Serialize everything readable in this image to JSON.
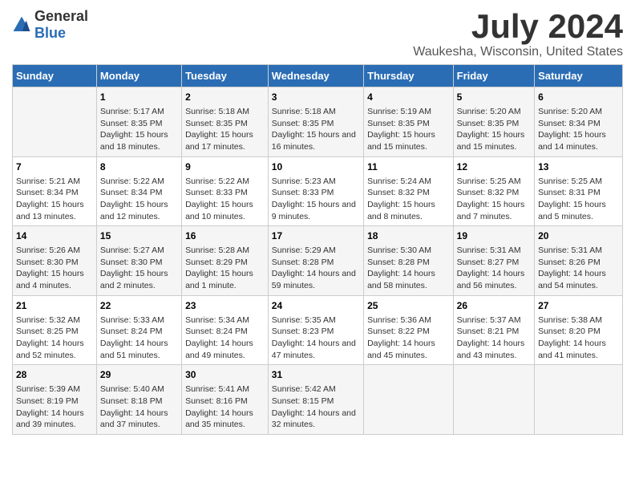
{
  "logo": {
    "general": "General",
    "blue": "Blue"
  },
  "header": {
    "title": "July 2024",
    "subtitle": "Waukesha, Wisconsin, United States"
  },
  "columns": [
    "Sunday",
    "Monday",
    "Tuesday",
    "Wednesday",
    "Thursday",
    "Friday",
    "Saturday"
  ],
  "weeks": [
    [
      {
        "day": "",
        "info": ""
      },
      {
        "day": "1",
        "info": "Sunrise: 5:17 AM\nSunset: 8:35 PM\nDaylight: 15 hours and 18 minutes."
      },
      {
        "day": "2",
        "info": "Sunrise: 5:18 AM\nSunset: 8:35 PM\nDaylight: 15 hours and 17 minutes."
      },
      {
        "day": "3",
        "info": "Sunrise: 5:18 AM\nSunset: 8:35 PM\nDaylight: 15 hours and 16 minutes."
      },
      {
        "day": "4",
        "info": "Sunrise: 5:19 AM\nSunset: 8:35 PM\nDaylight: 15 hours and 15 minutes."
      },
      {
        "day": "5",
        "info": "Sunrise: 5:20 AM\nSunset: 8:35 PM\nDaylight: 15 hours and 15 minutes."
      },
      {
        "day": "6",
        "info": "Sunrise: 5:20 AM\nSunset: 8:34 PM\nDaylight: 15 hours and 14 minutes."
      }
    ],
    [
      {
        "day": "7",
        "info": "Sunrise: 5:21 AM\nSunset: 8:34 PM\nDaylight: 15 hours and 13 minutes."
      },
      {
        "day": "8",
        "info": "Sunrise: 5:22 AM\nSunset: 8:34 PM\nDaylight: 15 hours and 12 minutes."
      },
      {
        "day": "9",
        "info": "Sunrise: 5:22 AM\nSunset: 8:33 PM\nDaylight: 15 hours and 10 minutes."
      },
      {
        "day": "10",
        "info": "Sunrise: 5:23 AM\nSunset: 8:33 PM\nDaylight: 15 hours and 9 minutes."
      },
      {
        "day": "11",
        "info": "Sunrise: 5:24 AM\nSunset: 8:32 PM\nDaylight: 15 hours and 8 minutes."
      },
      {
        "day": "12",
        "info": "Sunrise: 5:25 AM\nSunset: 8:32 PM\nDaylight: 15 hours and 7 minutes."
      },
      {
        "day": "13",
        "info": "Sunrise: 5:25 AM\nSunset: 8:31 PM\nDaylight: 15 hours and 5 minutes."
      }
    ],
    [
      {
        "day": "14",
        "info": "Sunrise: 5:26 AM\nSunset: 8:30 PM\nDaylight: 15 hours and 4 minutes."
      },
      {
        "day": "15",
        "info": "Sunrise: 5:27 AM\nSunset: 8:30 PM\nDaylight: 15 hours and 2 minutes."
      },
      {
        "day": "16",
        "info": "Sunrise: 5:28 AM\nSunset: 8:29 PM\nDaylight: 15 hours and 1 minute."
      },
      {
        "day": "17",
        "info": "Sunrise: 5:29 AM\nSunset: 8:28 PM\nDaylight: 14 hours and 59 minutes."
      },
      {
        "day": "18",
        "info": "Sunrise: 5:30 AM\nSunset: 8:28 PM\nDaylight: 14 hours and 58 minutes."
      },
      {
        "day": "19",
        "info": "Sunrise: 5:31 AM\nSunset: 8:27 PM\nDaylight: 14 hours and 56 minutes."
      },
      {
        "day": "20",
        "info": "Sunrise: 5:31 AM\nSunset: 8:26 PM\nDaylight: 14 hours and 54 minutes."
      }
    ],
    [
      {
        "day": "21",
        "info": "Sunrise: 5:32 AM\nSunset: 8:25 PM\nDaylight: 14 hours and 52 minutes."
      },
      {
        "day": "22",
        "info": "Sunrise: 5:33 AM\nSunset: 8:24 PM\nDaylight: 14 hours and 51 minutes."
      },
      {
        "day": "23",
        "info": "Sunrise: 5:34 AM\nSunset: 8:24 PM\nDaylight: 14 hours and 49 minutes."
      },
      {
        "day": "24",
        "info": "Sunrise: 5:35 AM\nSunset: 8:23 PM\nDaylight: 14 hours and 47 minutes."
      },
      {
        "day": "25",
        "info": "Sunrise: 5:36 AM\nSunset: 8:22 PM\nDaylight: 14 hours and 45 minutes."
      },
      {
        "day": "26",
        "info": "Sunrise: 5:37 AM\nSunset: 8:21 PM\nDaylight: 14 hours and 43 minutes."
      },
      {
        "day": "27",
        "info": "Sunrise: 5:38 AM\nSunset: 8:20 PM\nDaylight: 14 hours and 41 minutes."
      }
    ],
    [
      {
        "day": "28",
        "info": "Sunrise: 5:39 AM\nSunset: 8:19 PM\nDaylight: 14 hours and 39 minutes."
      },
      {
        "day": "29",
        "info": "Sunrise: 5:40 AM\nSunset: 8:18 PM\nDaylight: 14 hours and 37 minutes."
      },
      {
        "day": "30",
        "info": "Sunrise: 5:41 AM\nSunset: 8:16 PM\nDaylight: 14 hours and 35 minutes."
      },
      {
        "day": "31",
        "info": "Sunrise: 5:42 AM\nSunset: 8:15 PM\nDaylight: 14 hours and 32 minutes."
      },
      {
        "day": "",
        "info": ""
      },
      {
        "day": "",
        "info": ""
      },
      {
        "day": "",
        "info": ""
      }
    ]
  ]
}
